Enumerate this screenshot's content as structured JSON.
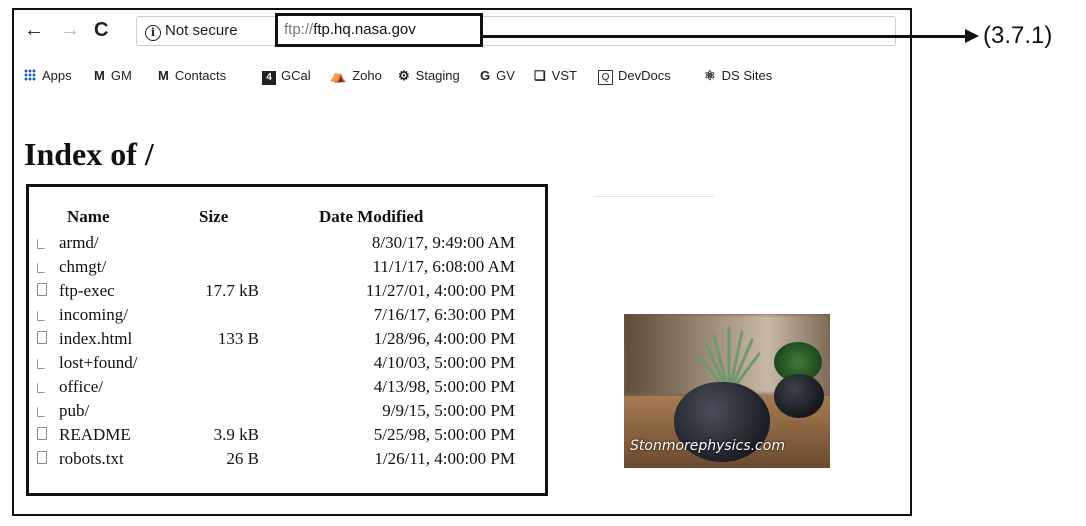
{
  "toolbar": {
    "back_icon": "←",
    "forward_icon": "→",
    "reload_icon": "C",
    "security_label": "Not secure",
    "url_scheme": "ftp://",
    "url_host": "ftp.hq.nasa.gov"
  },
  "bookmarks": [
    {
      "label": "Apps"
    },
    {
      "label": "GM",
      "icon": "M"
    },
    {
      "label": "Contacts",
      "icon": "M"
    },
    {
      "label": "GCal",
      "icon": "4"
    },
    {
      "label": "Zoho",
      "icon": "⛺"
    },
    {
      "label": "Staging",
      "icon": "⚙"
    },
    {
      "label": "GV",
      "icon": "G"
    },
    {
      "label": "VST",
      "icon": "❏"
    },
    {
      "label": "DevDocs",
      "icon": "Q"
    },
    {
      "label": "DS Sites",
      "icon": "⚛"
    }
  ],
  "page": {
    "title": "Index of /",
    "columns": {
      "name": "Name",
      "size": "Size",
      "date": "Date Modified"
    },
    "entries": [
      {
        "name": "armd/",
        "size": "",
        "date": "8/30/17, 9:49:00 AM",
        "type": "folder"
      },
      {
        "name": "chmgt/",
        "size": "",
        "date": "11/1/17, 6:08:00 AM",
        "type": "folder"
      },
      {
        "name": "ftp-exec",
        "size": "17.7 kB",
        "date": "11/27/01, 4:00:00 PM",
        "type": "file"
      },
      {
        "name": "incoming/",
        "size": "",
        "date": "7/16/17, 6:30:00 PM",
        "type": "folder"
      },
      {
        "name": "index.html",
        "size": "133 B",
        "date": "1/28/96, 4:00:00 PM",
        "type": "file"
      },
      {
        "name": "lost+found/",
        "size": "",
        "date": "4/10/03, 5:00:00 PM",
        "type": "folder"
      },
      {
        "name": "office/",
        "size": "",
        "date": "4/13/98, 5:00:00 PM",
        "type": "folder"
      },
      {
        "name": "pub/",
        "size": "",
        "date": "9/9/15, 5:00:00 PM",
        "type": "folder"
      },
      {
        "name": "README",
        "size": "3.9 kB",
        "date": "5/25/98, 5:00:00 PM",
        "type": "file"
      },
      {
        "name": "robots.txt",
        "size": "26 B",
        "date": "1/26/11, 4:00:00 PM",
        "type": "file"
      }
    ]
  },
  "thumbnail": {
    "watermark": "Stonmorephysics.com"
  },
  "callout": {
    "label": "(3.7.1)"
  }
}
